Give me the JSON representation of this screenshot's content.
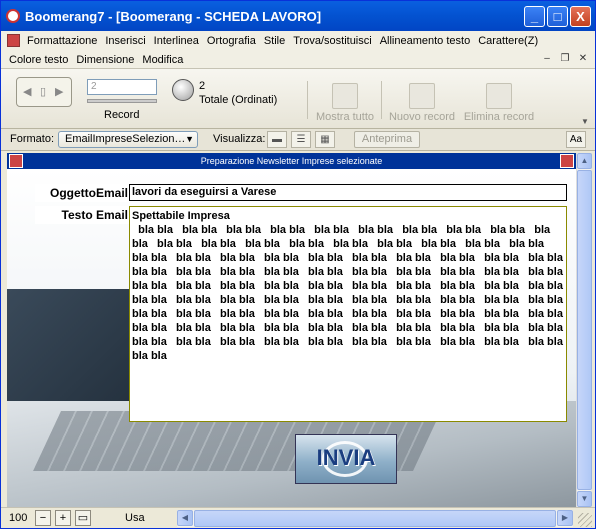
{
  "window": {
    "title": "Boomerang7 - [Boomerang - SCHEDA LAVORO]"
  },
  "titlebar_buttons": {
    "minimize": "_",
    "maximize": "□",
    "close": "X"
  },
  "menu": {
    "row1": [
      "Formattazione",
      "Inserisci",
      "Interlinea",
      "Ortografia",
      "Stile",
      "Trova/sostituisci",
      "Allineamento testo",
      "Carattere(Z)"
    ],
    "row2": [
      "Colore testo",
      "Dimensione",
      "Modifica"
    ],
    "mdi": {
      "min": "–",
      "restore": "❐",
      "close": "✕"
    }
  },
  "status": {
    "record_value": "2",
    "record_label": "Record",
    "count": "2",
    "count_label": "Totale (Ordinati)",
    "tools": {
      "show_all": "Mostra tutto",
      "new_record": "Nuovo record",
      "delete_record": "Elimina record"
    }
  },
  "format_bar": {
    "format_label": "Formato:",
    "format_value": "EmailImpreseSelezion…",
    "view_label": "Visualizza:",
    "preview": "Anteprima",
    "aa": "Aa"
  },
  "form": {
    "header": "Preparazione Newsletter Imprese selezionate",
    "subject_label": "OggettoEmail",
    "subject_value": "lavori da eseguirsi a Varese",
    "body_label": "Testo Email",
    "body_value": "Spettabile Impresa\n  bla bla   bla bla   bla bla   bla bla   bla bla   bla bla   bla bla   bla bla   bla bla   bla\nbla   bla bla   bla bla   bla bla   bla bla   bla bla   bla bla   bla bla   bla bla   bla bla\nbla bla   bla bla   bla bla   bla bla   bla bla   bla bla   bla bla   bla bla   bla bla   bla bla\nbla bla   bla bla   bla bla   bla bla   bla bla   bla bla   bla bla   bla bla   bla bla   bla bla\nbla bla   bla bla   bla bla   bla bla   bla bla   bla bla   bla bla   bla bla   bla bla   bla bla\nbla bla   bla bla   bla bla   bla bla   bla bla   bla bla   bla bla   bla bla   bla bla   bla bla\nbla bla   bla bla   bla bla   bla bla   bla bla   bla bla   bla bla   bla bla   bla bla   bla bla\nbla bla   bla bla   bla bla   bla bla   bla bla   bla bla   bla bla   bla bla   bla bla   bla bla\nbla bla   bla bla   bla bla   bla bla   bla bla   bla bla   bla bla   bla bla   bla bla   bla bla\nbla bla",
    "send_button": "INVIA"
  },
  "bottom": {
    "zoom": "100",
    "mode": "Usa"
  },
  "colors": {
    "title_blue": "#0352d0",
    "header_blue": "#003399",
    "background": "#ece9d8"
  }
}
